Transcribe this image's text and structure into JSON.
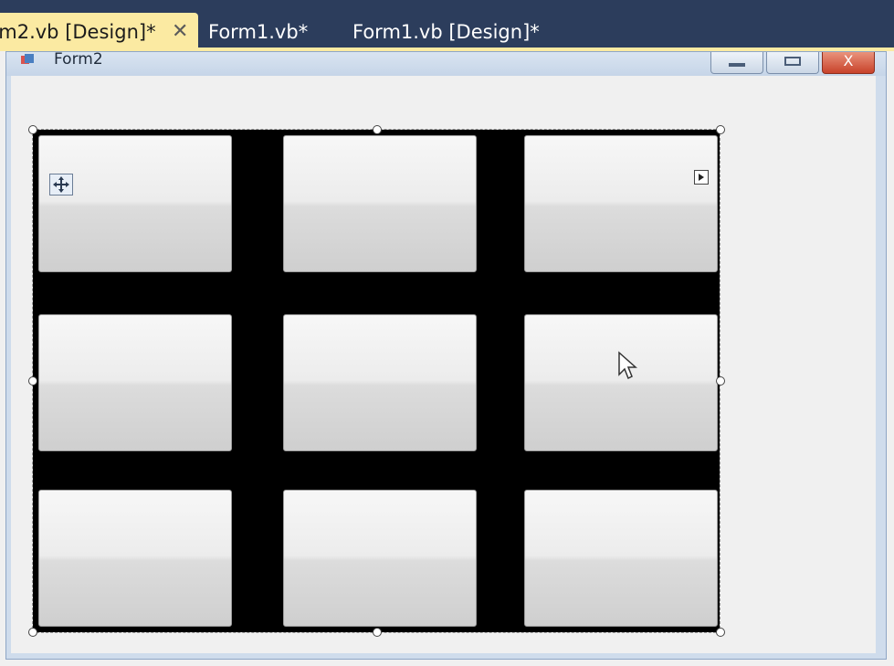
{
  "tabs": [
    {
      "label": "rm2.vb [Design]*",
      "active": true,
      "close_glyph": "✕"
    },
    {
      "label": "Form1.vb*",
      "active": false
    },
    {
      "label": "Form1.vb [Design]*",
      "active": false
    }
  ],
  "form": {
    "title": "Form2",
    "icon": "form-icon",
    "caption_buttons": [
      "minimize-icon",
      "maximize-icon",
      "close-icon"
    ],
    "close_glyph": "X"
  },
  "table_layout_panel": {
    "rows": 3,
    "columns": 3,
    "background": "#000000",
    "button_count": 9
  },
  "colors": {
    "tab_strip": "#2c3d5c",
    "active_tab": "#fbeaa2",
    "close_button": "#c8422a"
  }
}
